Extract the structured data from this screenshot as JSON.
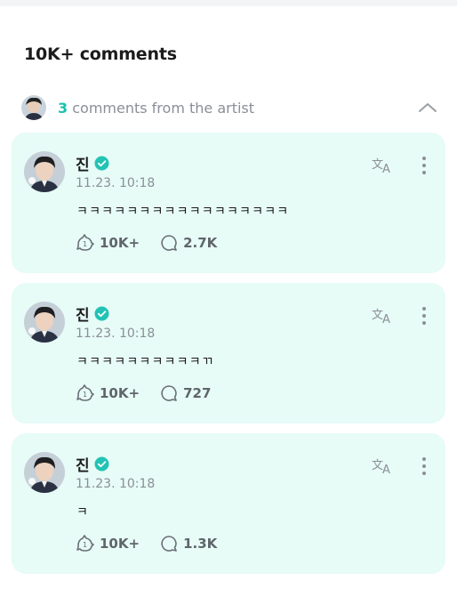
{
  "header": {
    "title": "10K+ comments"
  },
  "artist_section": {
    "count": "3",
    "label": " comments from the artist"
  },
  "comments": [
    {
      "author": "진",
      "timestamp": "11.23. 10:18",
      "text": "ㅋㅋㅋㅋㅋㅋㅋㅋㅋㅋㅋㅋㅋㅋㅋㅋㅋ",
      "likes": "10K+",
      "replies": "2.7K"
    },
    {
      "author": "진",
      "timestamp": "11.23. 10:18",
      "text": "ㅋㅋㅋㅋㅋㅋㅋㅋㅋㅋㄲ",
      "likes": "10K+",
      "replies": "727"
    },
    {
      "author": "진",
      "timestamp": "11.23. 10:18",
      "text": "ㅋ",
      "likes": "10K+",
      "replies": "1.3K"
    }
  ],
  "colors": {
    "accent": "#18c2b0",
    "card_bg": "#e7fbf7",
    "verified": "#22c3b4",
    "muted": "#8a8f96"
  },
  "icons": [
    "chevron-up-icon",
    "verified-icon",
    "translate-icon",
    "more-vertical-icon",
    "like-icon",
    "reply-icon"
  ]
}
